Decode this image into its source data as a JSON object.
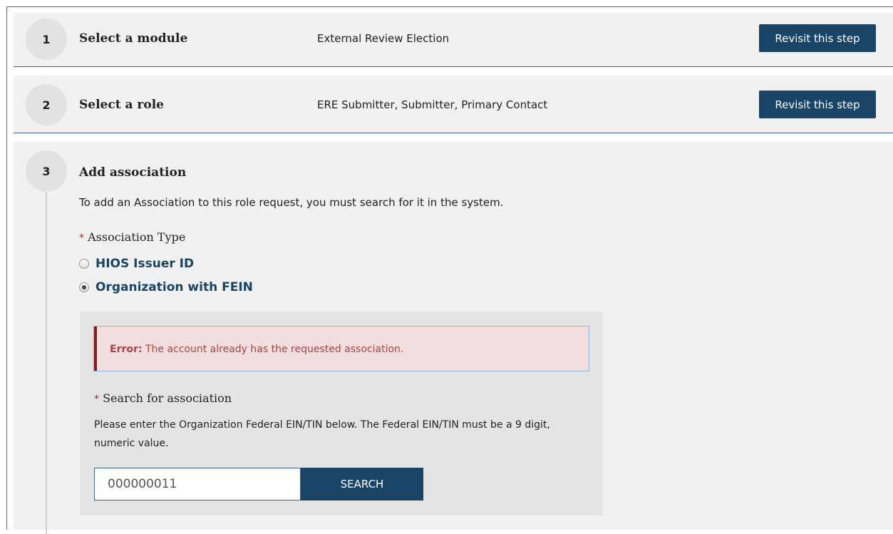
{
  "steps": [
    {
      "number": "1",
      "title": "Select a module",
      "value": "External Review Election",
      "button": "Revisit this step"
    },
    {
      "number": "2",
      "title": "Select a role",
      "value": "ERE Submitter, Submitter, Primary Contact",
      "button": "Revisit this step"
    },
    {
      "number": "3",
      "title": "Add association"
    }
  ],
  "association": {
    "intro": "To add an Association to this role request, you must search for it in the system.",
    "required_marker": "*",
    "type_label": "Association Type",
    "options": [
      {
        "label": "HIOS Issuer ID",
        "checked": false
      },
      {
        "label": "Organization with FEIN",
        "checked": true
      }
    ]
  },
  "search": {
    "error_prefix": "Error:",
    "error_message": "The account already has the requested association.",
    "label": "Search for association",
    "help": "Please enter the Organization Federal EIN/TIN below. The Federal EIN/TIN must be a 9 digit, numeric value.",
    "value": "000000011",
    "button": "SEARCH"
  },
  "colors": {
    "primary": "#1a4466",
    "error_bg": "#f2dede",
    "error_text": "#a94442"
  }
}
